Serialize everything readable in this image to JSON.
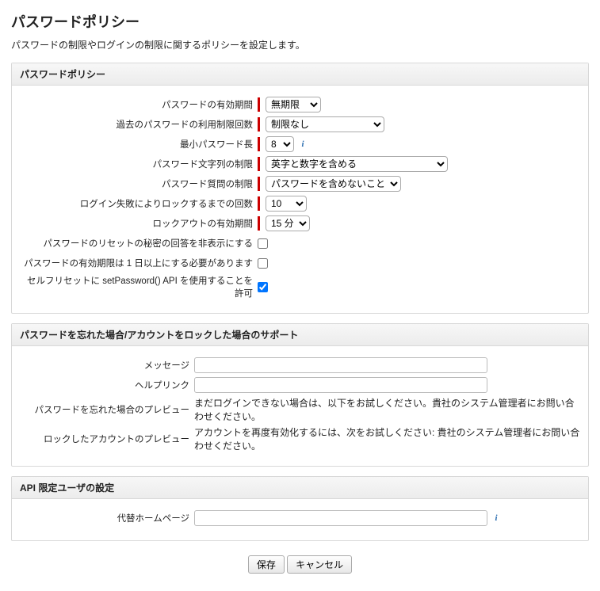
{
  "page": {
    "title": "パスワードポリシー",
    "subtitle": "パスワードの制限やログインの制限に関するポリシーを設定します。"
  },
  "sections": {
    "policy": {
      "header": "パスワードポリシー",
      "rows": {
        "expiry": {
          "label": "パスワードの有効期間",
          "value": "無期限"
        },
        "history": {
          "label": "過去のパスワードの利用制限回数",
          "value": "制限なし"
        },
        "minlen": {
          "label": "最小パスワード長",
          "value": "8"
        },
        "complexity": {
          "label": "パスワード文字列の制限",
          "value": "英字と数字を含める"
        },
        "question": {
          "label": "パスワード質問の制限",
          "value": "パスワードを含めないこと"
        },
        "lockattempts": {
          "label": "ログイン失敗によりロックするまでの回数",
          "value": "10"
        },
        "lockduration": {
          "label": "ロックアウトの有効期間",
          "value": "15 分"
        },
        "obscure": {
          "label": "パスワードのリセットの秘密の回答を非表示にする",
          "checked": false
        },
        "mindays": {
          "label": "パスワードの有効期限は 1 日以上にする必要があります",
          "checked": false
        },
        "setpwapi": {
          "label": "セルフリセットに setPassword() API を使用することを許可",
          "checked": true
        }
      }
    },
    "forgot": {
      "header": "パスワードを忘れた場合/アカウントをロックした場合のサポート",
      "rows": {
        "message": {
          "label": "メッセージ",
          "value": ""
        },
        "helplink": {
          "label": "ヘルプリンク",
          "value": ""
        },
        "forgotPreview": {
          "label": "パスワードを忘れた場合のプレビュー",
          "text": "まだログインできない場合は、以下をお試しください。貴社のシステム管理者にお問い合わせください。"
        },
        "lockPreview": {
          "label": "ロックしたアカウントのプレビュー",
          "text": "アカウントを再度有効化するには、次をお試しください: 貴社のシステム管理者にお問い合わせください。"
        }
      }
    },
    "api": {
      "header": "API 限定ユーザの設定",
      "rows": {
        "althome": {
          "label": "代替ホームページ",
          "value": ""
        }
      }
    }
  },
  "buttons": {
    "save": "保存",
    "cancel": "キャンセル"
  }
}
